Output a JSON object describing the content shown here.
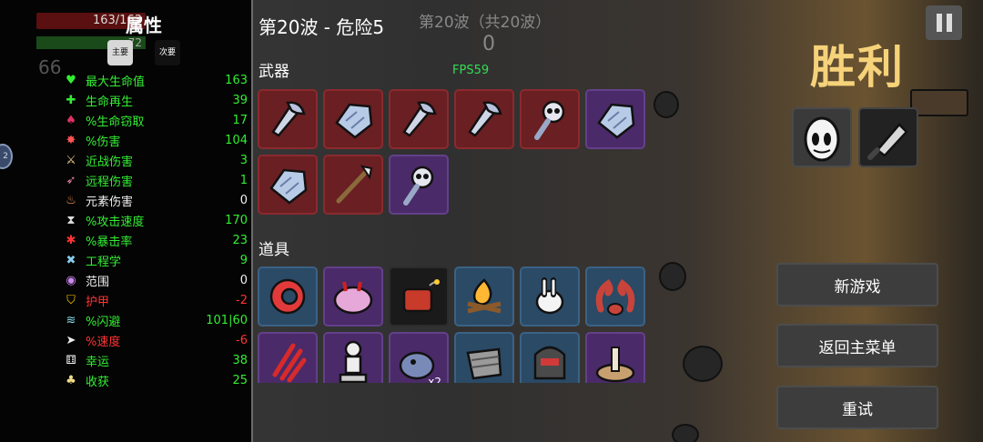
{
  "player": {
    "hp_text": "163/163",
    "level_text": "72",
    "materials_text": "66"
  },
  "stats_panel": {
    "title": "属性",
    "tab_primary": "主要",
    "tab_secondary": "次要",
    "stats": [
      {
        "name": "最大生命值",
        "value": "163",
        "color": "green",
        "icon": "heart-icon",
        "glyph": "♥",
        "icon_color": "#33ee33"
      },
      {
        "name": "生命再生",
        "value": "39",
        "color": "green",
        "icon": "regen-icon",
        "glyph": "✚",
        "icon_color": "#33ee33"
      },
      {
        "name": "%生命窃取",
        "value": "17",
        "color": "green",
        "icon": "lifesteal-icon",
        "glyph": "♠",
        "icon_color": "#dd3366"
      },
      {
        "name": "%伤害",
        "value": "104",
        "color": "green",
        "icon": "damage-icon",
        "glyph": "✸",
        "icon_color": "#ff5555"
      },
      {
        "name": "近战伤害",
        "value": "3",
        "color": "green",
        "icon": "melee-icon",
        "glyph": "⚔",
        "icon_color": "#eecc88"
      },
      {
        "name": "远程伤害",
        "value": "1",
        "color": "green",
        "icon": "ranged-icon",
        "glyph": "➶",
        "icon_color": "#ee88aa"
      },
      {
        "name": "元素伤害",
        "value": "0",
        "color": "white",
        "icon": "elemental-icon",
        "glyph": "♨",
        "icon_color": "#ff9955"
      },
      {
        "name": "%攻击速度",
        "value": "170",
        "color": "green",
        "icon": "attack-speed-icon",
        "glyph": "⧗",
        "icon_color": "#dddddd"
      },
      {
        "name": "%暴击率",
        "value": "23",
        "color": "green",
        "icon": "crit-icon",
        "glyph": "✱",
        "icon_color": "#ff3333"
      },
      {
        "name": "工程学",
        "value": "9",
        "color": "green",
        "icon": "engineering-icon",
        "glyph": "✖",
        "icon_color": "#88ccee"
      },
      {
        "name": "范围",
        "value": "0",
        "color": "white",
        "icon": "range-icon",
        "glyph": "◉",
        "icon_color": "#cc88ee"
      },
      {
        "name": "护甲",
        "value": "-2",
        "color": "red",
        "icon": "armor-icon",
        "glyph": "⛉",
        "icon_color": "#ffcc00"
      },
      {
        "name": "%闪避",
        "value": "101|60",
        "color": "green",
        "icon": "dodge-icon",
        "glyph": "≋",
        "icon_color": "#88ddee"
      },
      {
        "name": "%速度",
        "value": "-6",
        "color": "red",
        "icon": "speed-icon",
        "glyph": "➤",
        "icon_color": "#eeeeee"
      },
      {
        "name": "幸运",
        "value": "38",
        "color": "green",
        "icon": "luck-icon",
        "glyph": "⚅",
        "icon_color": "#eeeeee"
      },
      {
        "name": "收获",
        "value": "25",
        "color": "green",
        "icon": "harvest-icon",
        "glyph": "♣",
        "icon_color": "#eedd88"
      }
    ]
  },
  "left_badge_text": "2",
  "wave": {
    "title": "第20波 - 危险5",
    "ghost_title": "第20波（共20波）",
    "ghost_number": "0"
  },
  "fps_text": "FPS59",
  "weapons_label": "武器",
  "items_label": "道具",
  "weapons": [
    {
      "name": "axe-weapon",
      "tier": "red",
      "art": "axe"
    },
    {
      "name": "rock-weapon",
      "tier": "red",
      "art": "rock"
    },
    {
      "name": "axe-weapon",
      "tier": "red",
      "art": "axe"
    },
    {
      "name": "axe-weapon",
      "tier": "red",
      "art": "axe"
    },
    {
      "name": "skull-staff-weapon",
      "tier": "red",
      "art": "skull"
    },
    {
      "name": "rock-weapon",
      "tier": "purple",
      "art": "rock"
    },
    {
      "name": "rock-weapon",
      "tier": "red",
      "art": "rock"
    },
    {
      "name": "spear-weapon",
      "tier": "red",
      "art": "spear"
    },
    {
      "name": "skull-staff-weapon",
      "tier": "purple",
      "art": "skull"
    }
  ],
  "items": [
    {
      "name": "ring-item",
      "tier": "blue",
      "art": "ring",
      "count": ""
    },
    {
      "name": "brain-item",
      "tier": "purple",
      "art": "brain",
      "count": ""
    },
    {
      "name": "dynamite-item",
      "tier": "black",
      "art": "dynamite",
      "count": ""
    },
    {
      "name": "campfire-item",
      "tier": "blue",
      "art": "fire",
      "count": ""
    },
    {
      "name": "bunny-item",
      "tier": "blue",
      "art": "bunny",
      "count": ""
    },
    {
      "name": "crab-claws-item",
      "tier": "blue",
      "art": "claws",
      "count": ""
    },
    {
      "name": "scar-item",
      "tier": "purple",
      "art": "scar",
      "count": ""
    },
    {
      "name": "statue-item",
      "tier": "purple",
      "art": "statue",
      "count": ""
    },
    {
      "name": "creature-item",
      "tier": "purple",
      "art": "creature",
      "count": "x2"
    },
    {
      "name": "scarf-item",
      "tier": "blue",
      "art": "scarf",
      "count": ""
    },
    {
      "name": "helmet-item",
      "tier": "blue",
      "art": "helmet",
      "count": ""
    },
    {
      "name": "mushroom-item",
      "tier": "purple",
      "art": "mushroom",
      "count": ""
    }
  ],
  "result": {
    "title": "胜利"
  },
  "menu": {
    "new_game": "新游戏",
    "main_menu": "返回主菜单",
    "retry": "重试"
  },
  "colors": {
    "victory": "#f6d27a",
    "stat_green": "#33ee33",
    "stat_red": "#ff3333"
  }
}
